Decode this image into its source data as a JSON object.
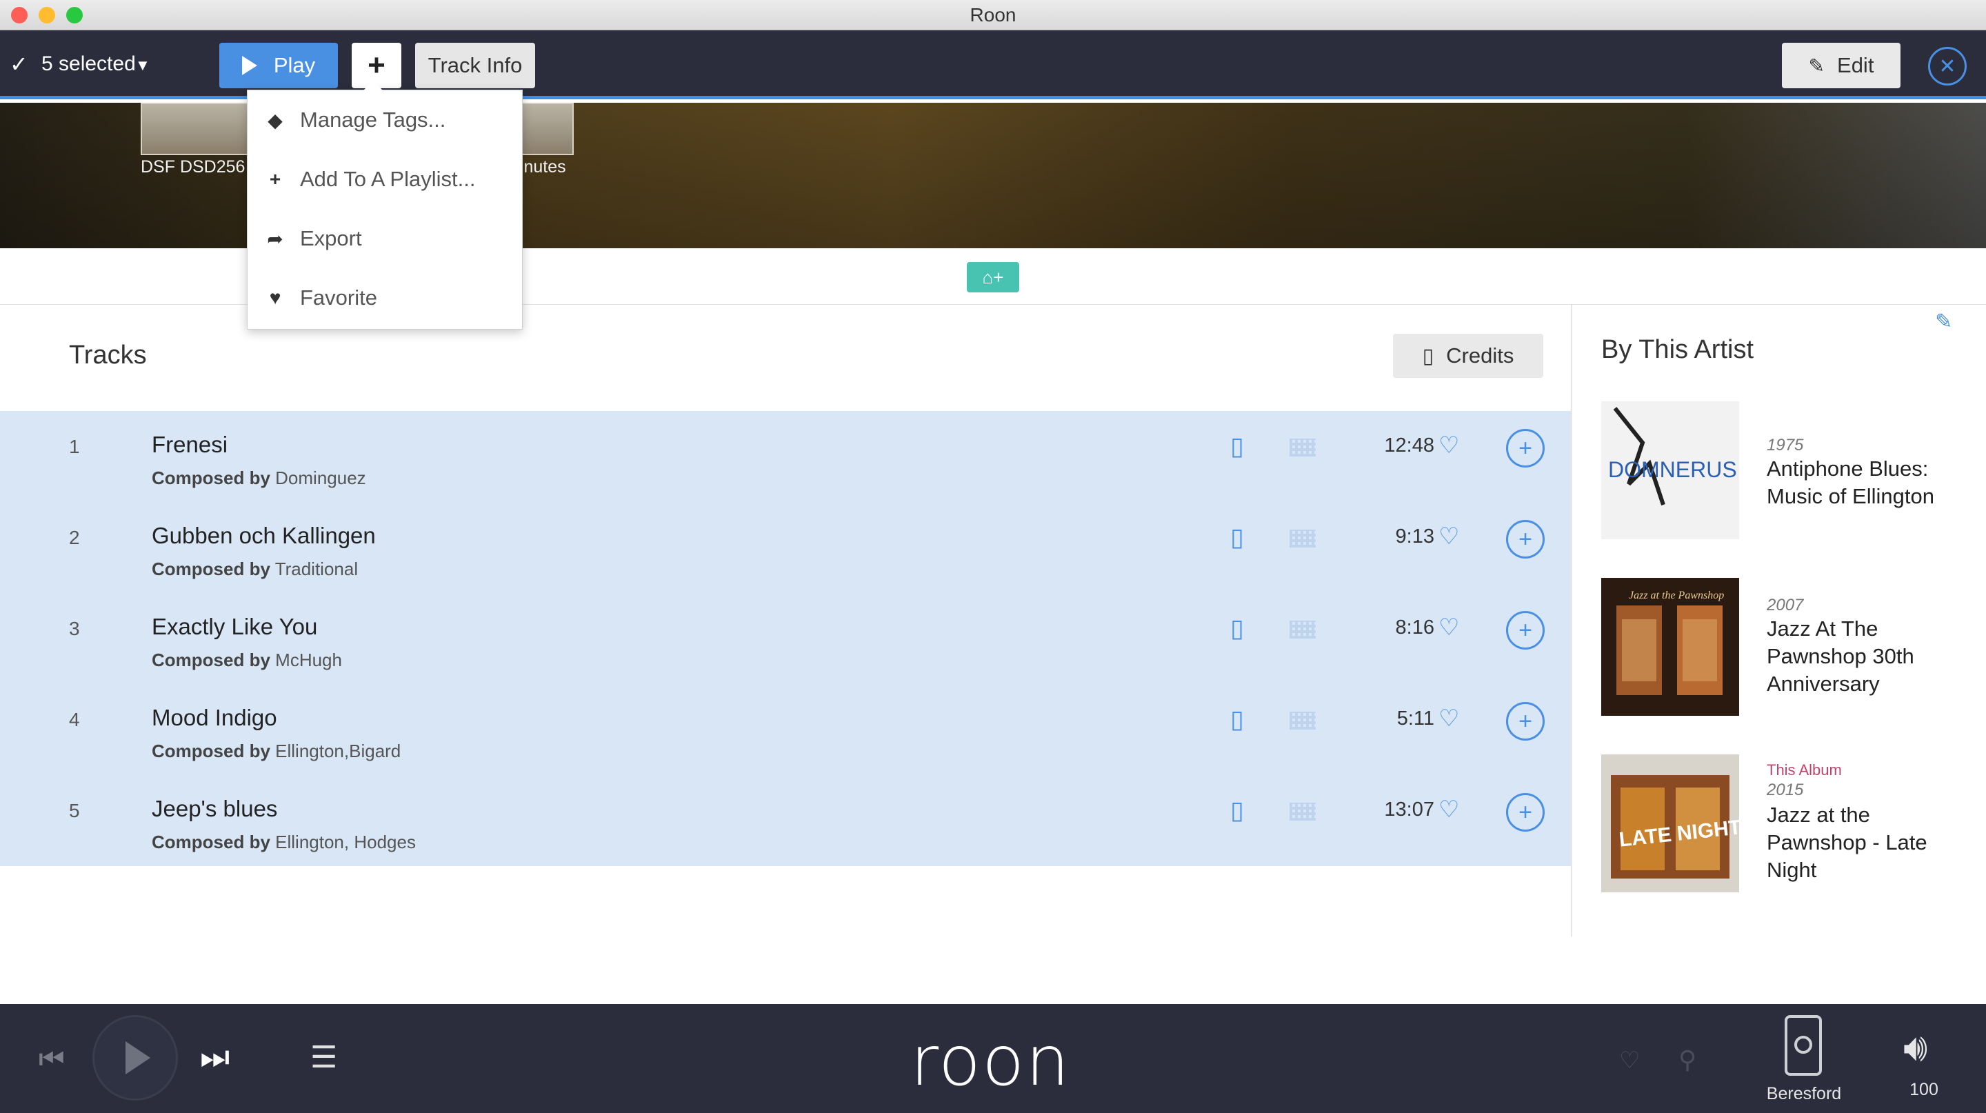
{
  "window": {
    "title": "Roon",
    "controls": [
      "close",
      "minimize",
      "zoom"
    ],
    "control_colors": [
      "#fd5f57",
      "#febc2e",
      "#28c840"
    ]
  },
  "toolbar": {
    "selected_label": "5 selected",
    "play_label": "Play",
    "add_label": "+",
    "track_info_label": "Track Info",
    "edit_label": "Edit",
    "accent_color": "#4a90e2"
  },
  "album_header": {
    "format_text": "DSF DSD256 2",
    "duration_fragment": "ninutes"
  },
  "menu": {
    "items": [
      {
        "icon": "tag-icon",
        "label": "Manage Tags..."
      },
      {
        "icon": "plus-icon",
        "label": "Add To A Playlist..."
      },
      {
        "icon": "share-icon",
        "label": "Export"
      },
      {
        "icon": "heart-icon",
        "label": "Favorite"
      }
    ]
  },
  "tracks": {
    "title": "Tracks",
    "credits_label": "Credits",
    "composer_prefix": "Composed by",
    "rows": [
      {
        "number": "1",
        "title": "Frenesi",
        "composer": "Dominguez",
        "duration": "12:48"
      },
      {
        "number": "2",
        "title": "Gubben och Kallingen",
        "composer": "Traditional",
        "duration": "9:13"
      },
      {
        "number": "3",
        "title": "Exactly Like You",
        "composer": "McHugh",
        "duration": "8:16"
      },
      {
        "number": "4",
        "title": "Mood Indigo",
        "composer": "Ellington,Bigard",
        "duration": "5:11"
      },
      {
        "number": "5",
        "title": "Jeep's blues",
        "composer": "Ellington, Hodges",
        "duration": "13:07"
      }
    ]
  },
  "by_artist": {
    "title": "By This Artist",
    "albums": [
      {
        "tag": "",
        "year": "1975",
        "title": "Antiphone Blues: Music of Ellington",
        "cover_text": "DOMNERUS ANTIPHONE BLUES"
      },
      {
        "tag": "",
        "year": "2007",
        "title": "Jazz At The Pawnshop 30th Anniversary",
        "cover_text": "Jazz at the Pawnshop"
      },
      {
        "tag": "This Album",
        "year": "2015",
        "title": "Jazz at the Pawnshop - Late Night",
        "cover_text": "LATE NIGHT"
      }
    ]
  },
  "player": {
    "logo": "roon",
    "zone_name": "Beresford",
    "volume": "100"
  }
}
